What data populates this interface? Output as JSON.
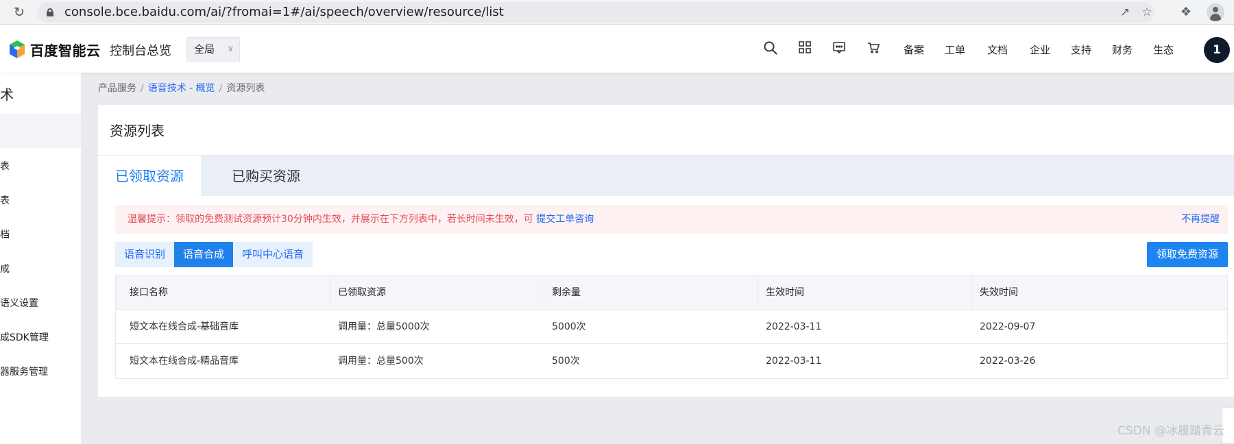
{
  "browser": {
    "url": "console.bce.baidu.com/ai/?fromai=1#/ai/speech/overview/resource/list"
  },
  "topnav": {
    "logo_text": "百度智能云",
    "console_title": "控制台总览",
    "scope_label": "全局",
    "links": [
      "备案",
      "工单",
      "文档",
      "企业",
      "支持",
      "财务",
      "生态"
    ],
    "avatar_label": "1"
  },
  "sidebar": {
    "title": "术",
    "items": [
      "表",
      "表",
      "档",
      "成",
      "语义设置",
      "成SDK管理",
      "器服务管理"
    ]
  },
  "breadcrumb": {
    "root": "产品服务",
    "parent": "语音技术 - 概览",
    "current": "资源列表"
  },
  "page": {
    "title": "资源列表",
    "tabs": [
      {
        "label": "已领取资源",
        "active": true
      },
      {
        "label": "已购买资源",
        "active": false
      }
    ],
    "notice": {
      "text": "温馨提示：领取的免费测试资源预计30分钟内生效，并展示在下方列表中，若长时间未生效，可",
      "link": "提交工单咨询",
      "dismiss": "不再提醒"
    },
    "filters": [
      {
        "label": "语音识别",
        "active": false
      },
      {
        "label": "语音合成",
        "active": true
      },
      {
        "label": "呼叫中心语音",
        "active": false
      }
    ],
    "primary_button": "领取免费资源"
  },
  "table": {
    "columns": [
      "接口名称",
      "已领取资源",
      "剩余量",
      "生效时间",
      "失效时间"
    ],
    "rows": [
      [
        "短文本在线合成-基础音库",
        "调用量：总量5000次",
        "5000次",
        "2022-03-11",
        "2022-09-07"
      ],
      [
        "短文本在线合成-精品音库",
        "调用量：总量500次",
        "500次",
        "2022-03-11",
        "2022-03-26"
      ]
    ]
  },
  "watermark": "CSDN @冰履踏青云",
  "colors": {
    "primary": "#2468f2",
    "button": "#1d84f0",
    "notice_bg": "#fdf1f1",
    "notice_text": "#e34d59"
  }
}
